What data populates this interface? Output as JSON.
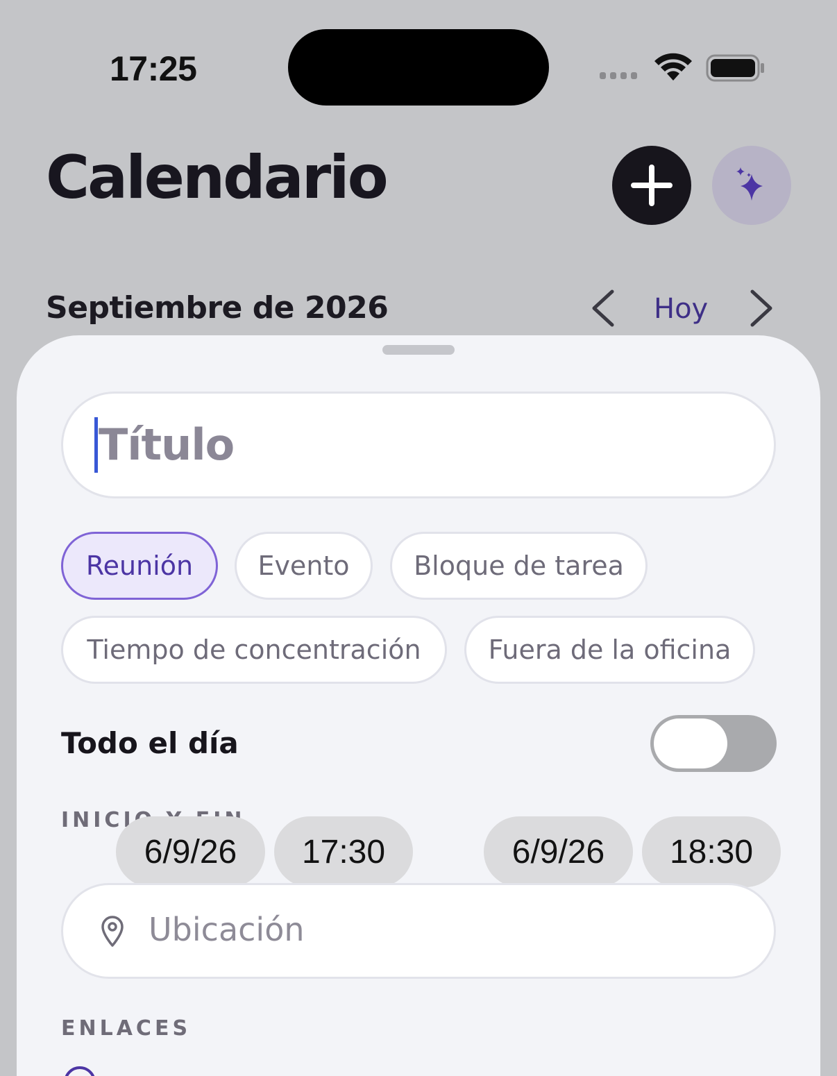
{
  "status_bar": {
    "time": "17:25",
    "signal_icon": "cellular-signal-icon",
    "wifi_icon": "wifi-icon",
    "battery_icon": "battery-icon"
  },
  "header": {
    "title": "Calendario",
    "add_icon": "plus-icon",
    "ai_icon": "sparkles-icon"
  },
  "month_nav": {
    "month": "Septiembre de 2026",
    "today": "Hoy",
    "prev_icon": "chevron-left-icon",
    "next_icon": "chevron-right-icon"
  },
  "sheet": {
    "title_placeholder": "Título",
    "event_types": [
      {
        "label": "Reunión",
        "selected": true
      },
      {
        "label": "Evento",
        "selected": false
      },
      {
        "label": "Bloque de tarea",
        "selected": false
      },
      {
        "label": "Tiempo de concentración",
        "selected": false
      },
      {
        "label": "Fuera de la oficina",
        "selected": false
      }
    ],
    "all_day_label": "Todo el día",
    "all_day_on": false,
    "start_end_label": "INICIO Y FIN",
    "start_date": "6/9/26",
    "start_time": "17:30",
    "end_date": "6/9/26",
    "end_time": "18:30",
    "location_placeholder": "Ubicación",
    "location_icon": "map-pin-icon",
    "links_label": "ENLACES"
  },
  "colors": {
    "accent": "#4c35a4",
    "selected_chip_bg": "#ece8fb",
    "toggle_off": "#a9aaad"
  }
}
